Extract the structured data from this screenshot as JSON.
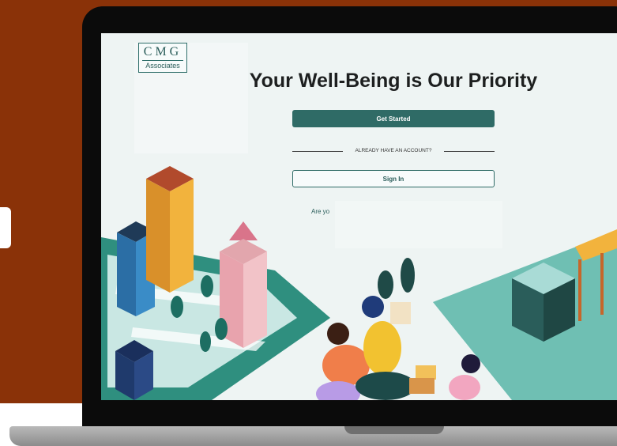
{
  "logo": {
    "top": "CMG",
    "bottom": "Associates"
  },
  "page": {
    "title": "Your Well-Being is Our Priority",
    "get_started": "Get Started",
    "divider": "ALREADY HAVE AN ACCOUNT?",
    "sign_in": "Sign In",
    "partial_text": "Are yo"
  },
  "colors": {
    "brand": "#2f6b66",
    "background": "#8a3208"
  }
}
